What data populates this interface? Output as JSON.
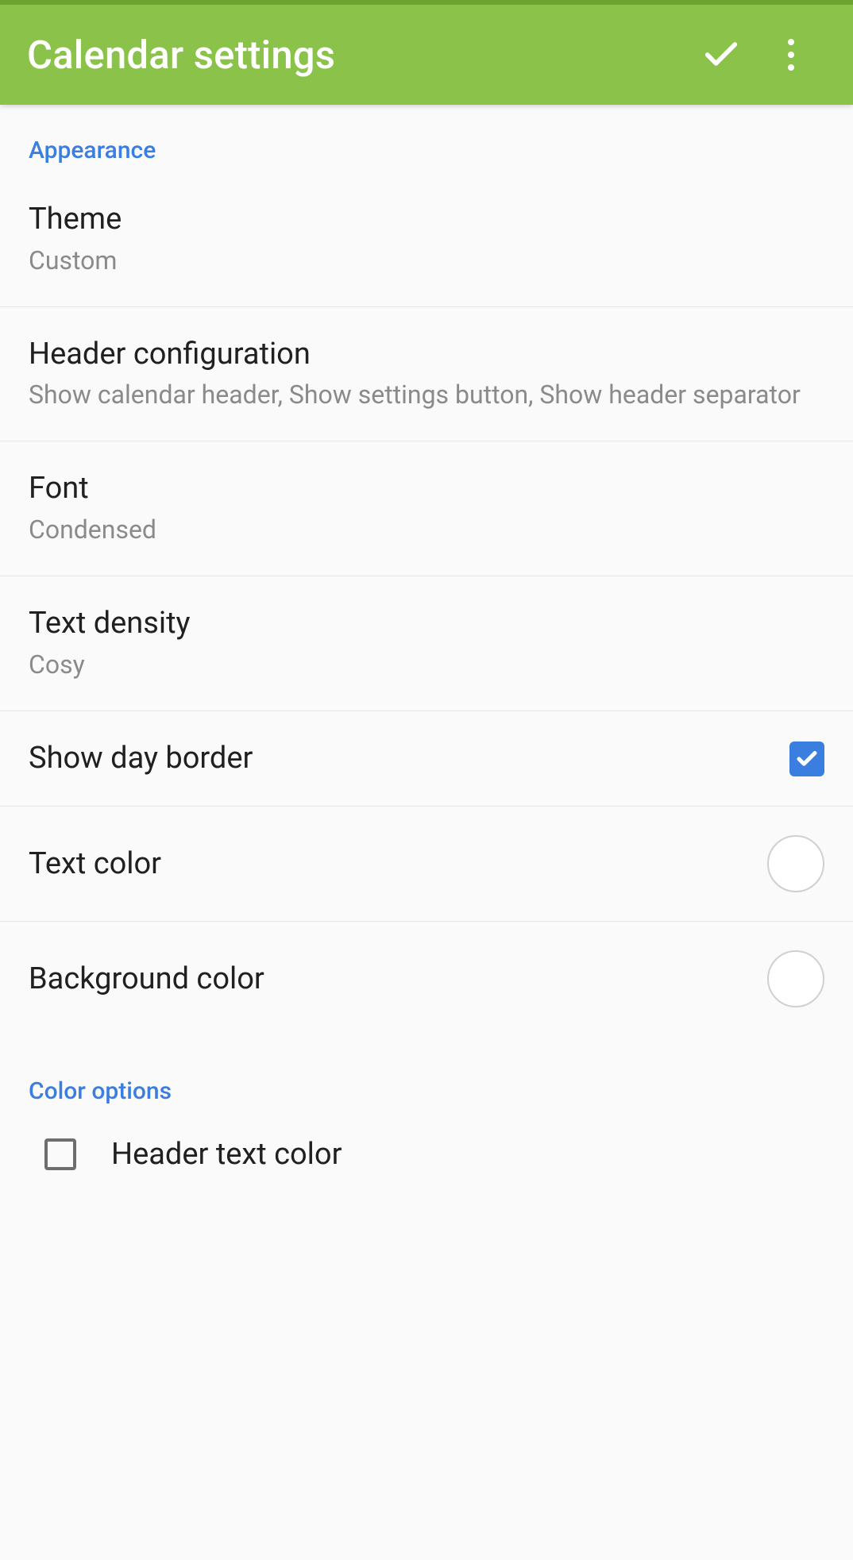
{
  "header": {
    "title": "Calendar settings"
  },
  "sections": {
    "appearance": {
      "header": "Appearance",
      "theme": {
        "title": "Theme",
        "value": "Custom"
      },
      "header_config": {
        "title": "Header configuration",
        "value": "Show calendar header, Show settings button, Show header separator"
      },
      "font": {
        "title": "Font",
        "value": "Condensed"
      },
      "text_density": {
        "title": "Text density",
        "value": "Cosy"
      },
      "show_day_border": {
        "title": "Show day border",
        "checked": true
      },
      "text_color": {
        "title": "Text color",
        "color": "#ffffff"
      },
      "background_color": {
        "title": "Background color",
        "color": "#ffffff"
      }
    },
    "color_options": {
      "header": "Color options",
      "header_text_color": {
        "title": "Header text color",
        "checked": false
      }
    }
  }
}
